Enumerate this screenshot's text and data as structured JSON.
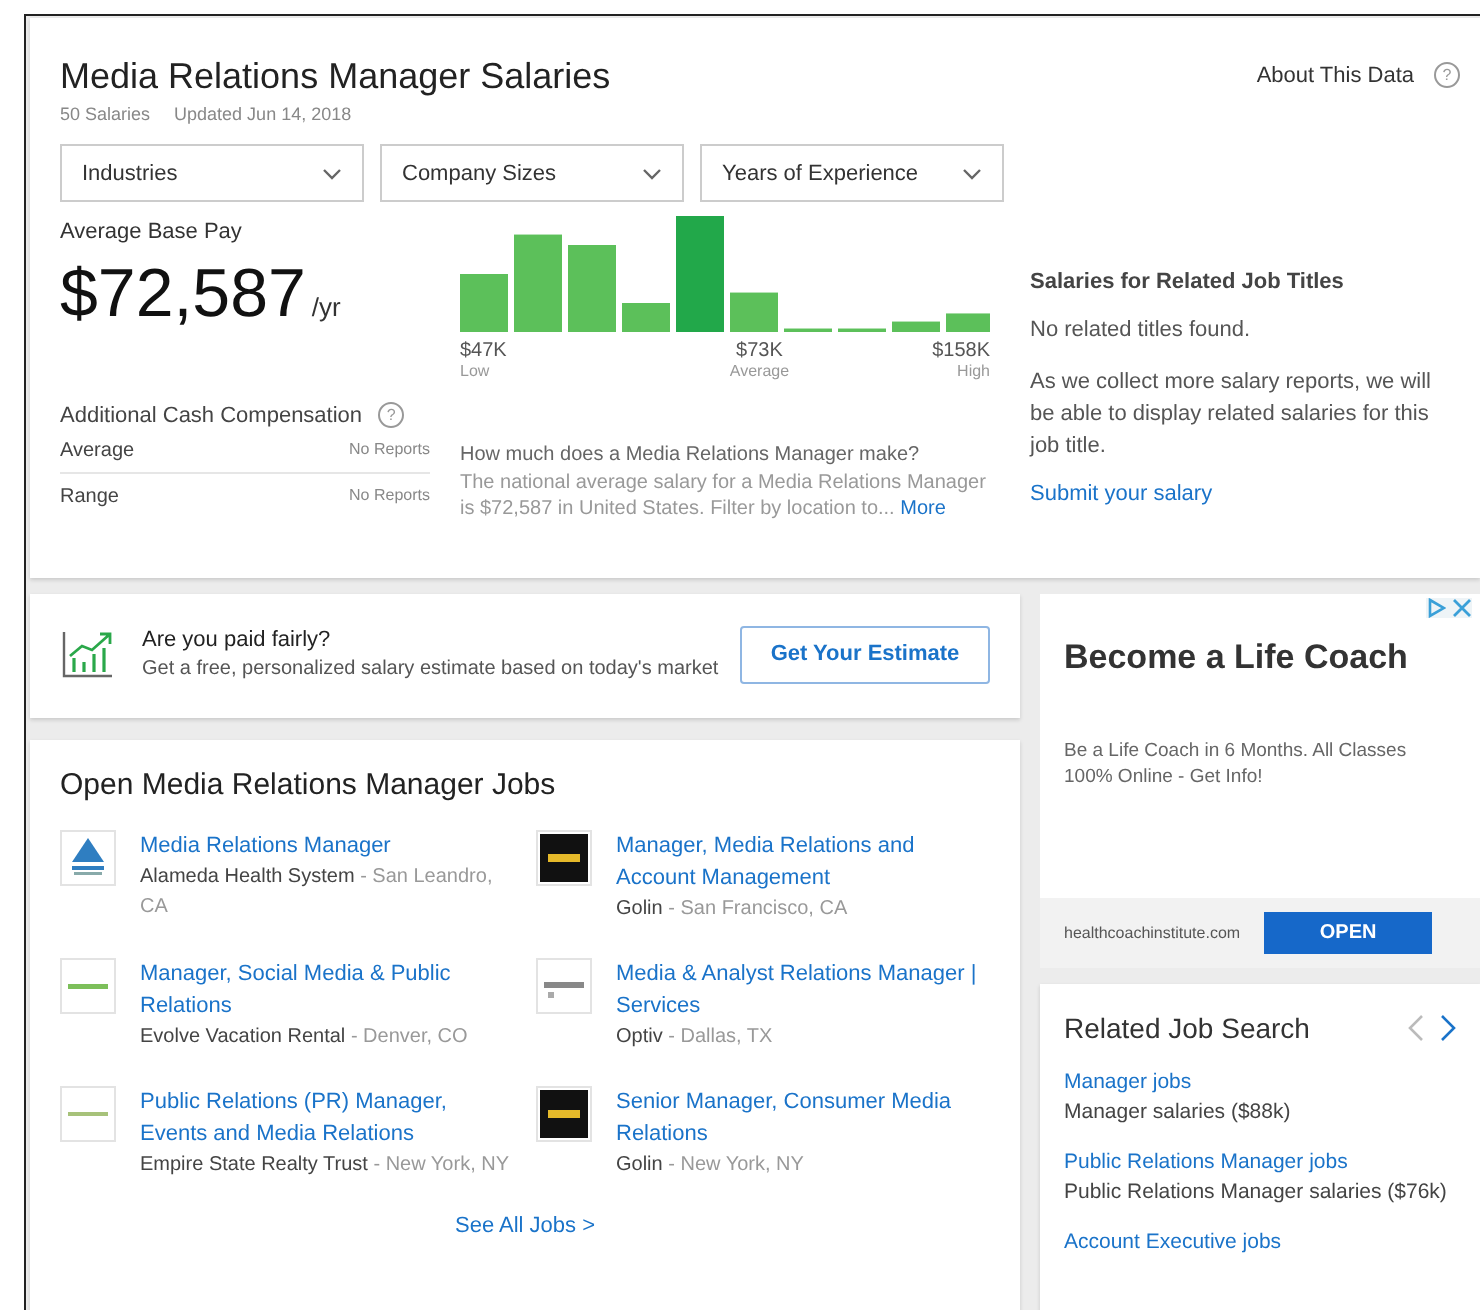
{
  "header": {
    "title": "Media Relations Manager Salaries",
    "salary_count": "50 Salaries",
    "updated": "Updated Jun 14, 2018",
    "about_link": "About This Data",
    "help_icon": "?"
  },
  "filters": [
    {
      "label": "Industries"
    },
    {
      "label": "Company Sizes"
    },
    {
      "label": "Years of Experience"
    }
  ],
  "base_pay": {
    "label": "Average Base Pay",
    "amount": "$72,587",
    "unit": "/yr"
  },
  "histogram": {
    "marks": [
      {
        "value": "$47K",
        "label": "Low"
      },
      {
        "value": "$73K",
        "label": "Average"
      },
      {
        "value": "$158K",
        "label": "High"
      }
    ]
  },
  "additional_cash": {
    "title": "Additional Cash Compensation",
    "help_icon": "?",
    "rows": [
      {
        "label": "Average",
        "value": "No Reports"
      },
      {
        "label": "Range",
        "value": "No Reports"
      }
    ]
  },
  "summary": {
    "question": "How much does a Media Relations Manager make?",
    "text": "The national average salary for a Media Relations Manager is $72,587 in United States. Filter by location to...",
    "more": "More"
  },
  "related_titles": {
    "title": "Salaries for Related Job Titles",
    "empty": "No related titles found.",
    "note": "As we collect more salary reports, we will be able to display related salaries for this job title.",
    "link": "Submit your salary"
  },
  "prompt": {
    "title": "Are you paid fairly?",
    "text": "Get a free, personalized salary estimate based on today's market",
    "button": "Get Your Estimate"
  },
  "jobs": {
    "title": "Open Media Relations Manager Jobs",
    "items": [
      {
        "title": "Media Relations Manager",
        "company": "Alameda Health System",
        "location": "- San Leandro, CA",
        "logo": {
          "kind": "triangle"
        }
      },
      {
        "title": "Manager, Media Relations and Account Management",
        "company": "Golin",
        "location": "- San Francisco, CA",
        "logo": {
          "kind": "dark"
        }
      },
      {
        "title": "Manager, Social Media & Public Relations",
        "company": "Evolve Vacation Rental",
        "location": "- Denver, CO",
        "logo": {
          "kind": "stripe"
        }
      },
      {
        "title": "Media & Analyst Relations Manager | Services",
        "company": "Optiv",
        "location": "- Dallas, TX",
        "logo": {
          "kind": "marks"
        }
      },
      {
        "title": "Public Relations (PR) Manager, Events and Media Relations",
        "company": "Empire State Realty Trust",
        "location": "- New York, NY",
        "logo": {
          "kind": "line"
        }
      },
      {
        "title": "Senior Manager, Consumer Media Relations",
        "company": "Golin",
        "location": "- New York, NY",
        "logo": {
          "kind": "dark"
        }
      }
    ],
    "see_all": "See All Jobs >"
  },
  "ad": {
    "headline": "Become a Life Coach",
    "body": "Be a Life Coach in 6 Months. All Classes 100% Online - Get Info!",
    "domain": "healthcoachinstitute.com",
    "button": "OPEN"
  },
  "related_search": {
    "title": "Related Job Search",
    "items": [
      {
        "link": "Manager jobs",
        "salary": "Manager salaries ($88k)"
      },
      {
        "link": "Public Relations Manager jobs",
        "salary": "Public Relations Manager salaries ($76k)"
      },
      {
        "link": "Account Executive jobs"
      }
    ]
  }
}
